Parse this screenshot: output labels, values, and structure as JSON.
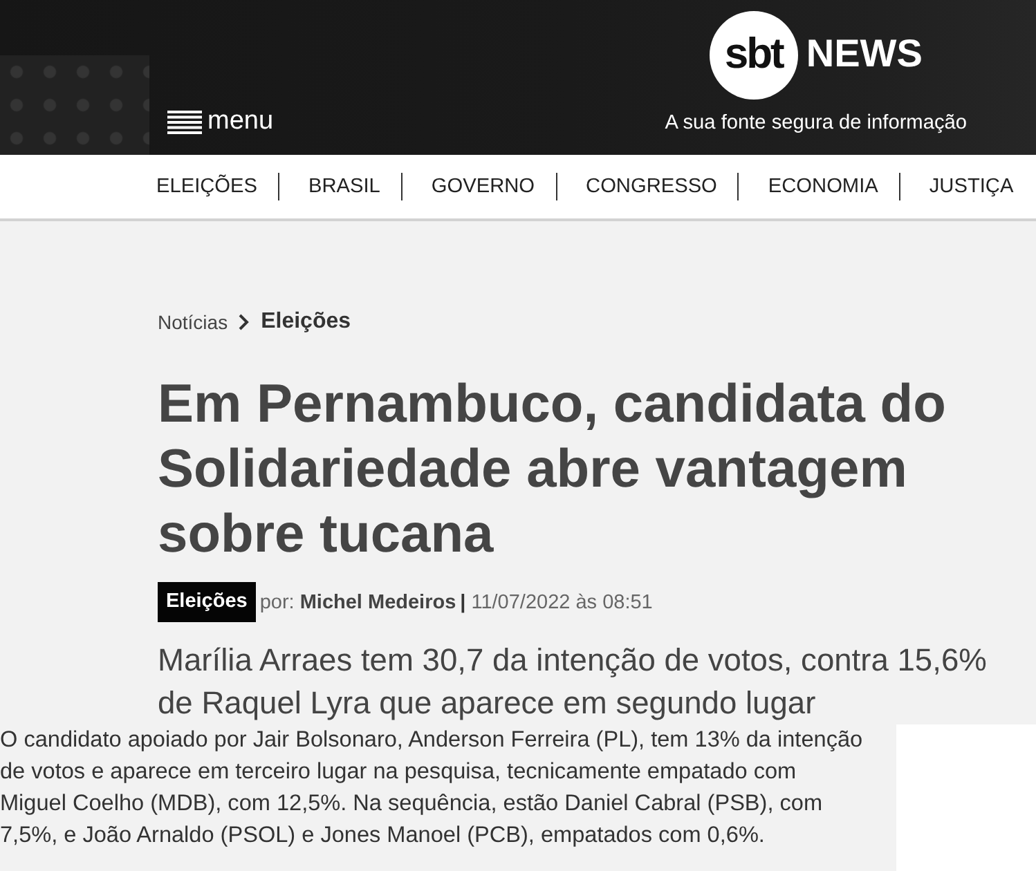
{
  "header": {
    "menu_label": "menu",
    "logo": {
      "mark": "sbt",
      "wordmark": "NEWS"
    },
    "tagline": "A sua fonte segura de informação"
  },
  "nav": [
    "ELEIÇÕES",
    "BRASIL",
    "GOVERNO",
    "CONGRESSO",
    "ECONOMIA",
    "JUSTIÇA"
  ],
  "breadcrumb": [
    {
      "label": "Notícias",
      "current": false
    },
    {
      "label": "Eleições",
      "current": true
    }
  ],
  "article": {
    "title": "Em Pernambuco, candidata do Solidariedade abre vantagem sobre tucana",
    "category_tag": "Eleições",
    "byline_prefix": "por:",
    "author": "Michel Medeiros",
    "byline_separator": "|",
    "date": "11/07/2022 às 08:51",
    "subtitle": "Marília Arraes tem 30,7 da intenção de votos, contra 15,6% de Raquel Lyra que aparece em segundo lugar",
    "body": "O candidato apoiado por Jair Bolsonaro, Anderson Ferreira (PL), tem 13% da intenção de votos e aparece em terceiro lugar na pesquisa, tecnicamente empatado com Miguel Coelho (MDB), com 12,5%. Na sequência, estão Daniel Cabral (PSB), com 7,5%, e João Arnaldo (PSOL) e Jones Manoel (PCB), empatados com 0,6%."
  }
}
